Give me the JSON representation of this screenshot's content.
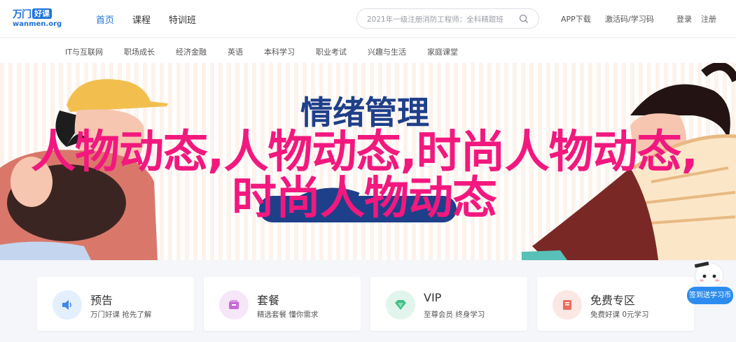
{
  "brand": {
    "name": "万门",
    "badge": "好课",
    "domain": "wanmen.org"
  },
  "nav": [
    {
      "label": "首页",
      "active": true
    },
    {
      "label": "课程",
      "active": false
    },
    {
      "label": "特训班",
      "active": false
    }
  ],
  "search": {
    "placeholder": "2021年一级注册消防工程师：全科精题班"
  },
  "top_links": {
    "app": "APP下载",
    "activate": "激活码/学习码",
    "login": "登录",
    "register": "注册"
  },
  "categories": [
    "IT与互联网",
    "职场成长",
    "经济金融",
    "英语",
    "本科学习",
    "职业考试",
    "兴趣与生活",
    "家庭课堂"
  ],
  "banner": {
    "title": "情绪管理",
    "overlay_text": "人物动态,人物动态,时尚人物动态,时尚人物动态"
  },
  "features": [
    {
      "title": "预告",
      "sub": "万门好课 抢先了解"
    },
    {
      "title": "套餐",
      "sub": "精选套餐 懂你需求"
    },
    {
      "title": "VIP",
      "sub": "至尊会员 终身学习"
    },
    {
      "title": "免费专区",
      "sub": "免费好课 0元学习"
    }
  ],
  "mascot": {
    "label": "签到送学习币"
  },
  "colors": {
    "accent": "#1e73d8",
    "overlay_text": "#f2187e",
    "banner_bg": "#fdf3ec"
  }
}
